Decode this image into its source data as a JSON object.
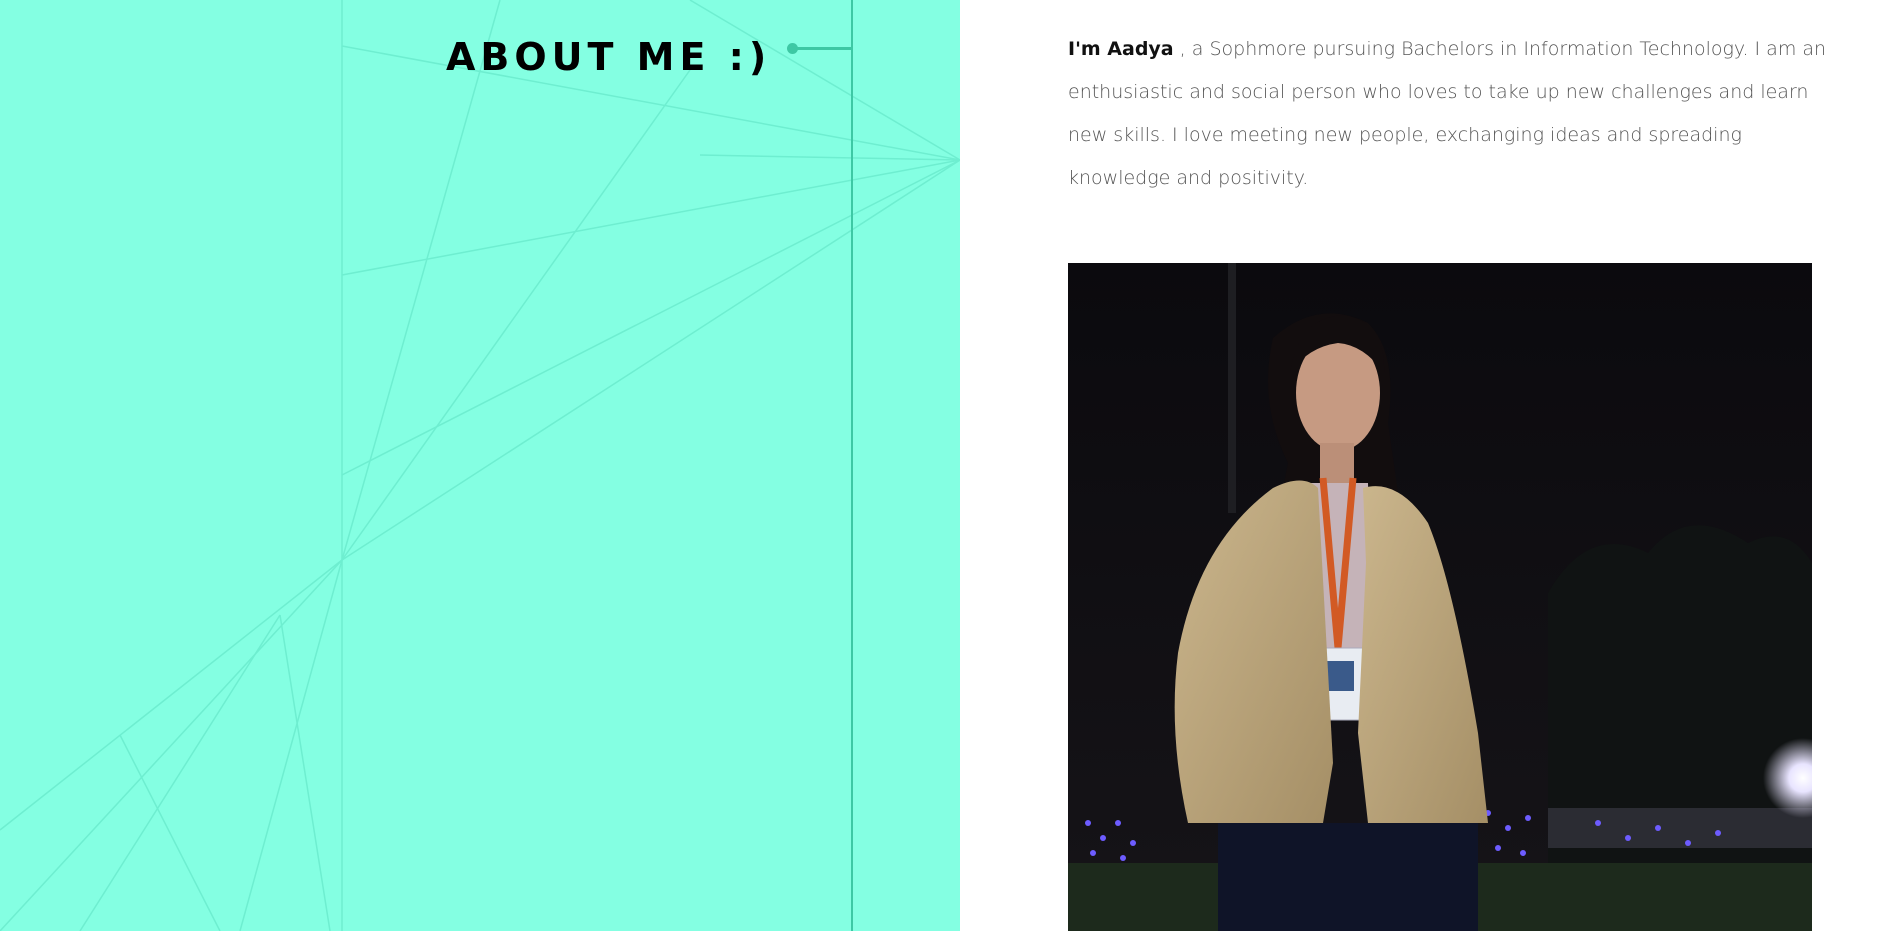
{
  "colors": {
    "panel_bg": "#84ffe2",
    "panel_lines": "#6eeed0",
    "accent": "#3ec8a4",
    "title_text": "#000000",
    "bio_text": "#555555",
    "bio_name": "#111111",
    "right_bg": "#ffffff"
  },
  "about": {
    "title": "ABOUT ME :)"
  },
  "bio": {
    "name": "I'm Aadya",
    "text": " , a Sophmore pursuing Bachelors in Information Technology. I am an enthusiastic and social person who loves to take up new challenges and learn new skills. I love meeting new people, exchanging ideas and spreading knowledge and positivity."
  }
}
